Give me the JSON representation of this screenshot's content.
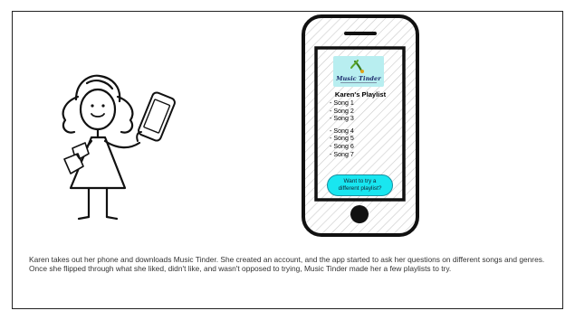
{
  "app": {
    "logo_text": "Music Tinder"
  },
  "playlist": {
    "title": "Karen's Playlist",
    "songs": [
      "- Song 1",
      "- Song 2",
      "- Song 3",
      "- Song 4",
      "- Song 5",
      "- Song 6",
      "- Song 7"
    ]
  },
  "button": {
    "label_line1": "Want to try a",
    "label_line2": "different playlist?"
  },
  "caption": "Karen takes out her phone and downloads Music Tinder. She created an account, and the app started to ask her questions on different songs and genres. Once she flipped through what she liked, didn't like, and wasn't opposed to trying, Music Tinder made her a few playlists to try.",
  "colors": {
    "logo_bg": "#b8eef0",
    "button_bg": "#19e6f0",
    "phone_outline": "#111111"
  },
  "icons": [
    "stick-figure-girl",
    "handheld-phone-icon",
    "fan-icon",
    "music-tinder-logo-icon",
    "home-button-icon"
  ]
}
